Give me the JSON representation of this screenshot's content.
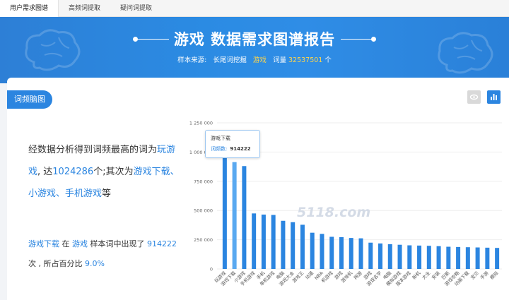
{
  "tabs": [
    {
      "label": "用户需求图谱",
      "active": true
    },
    {
      "label": "高频词提取",
      "active": false
    },
    {
      "label": "疑问词提取",
      "active": false
    }
  ],
  "banner": {
    "title": "游戏 数据需求图谱报告",
    "source_label": "样本来源:",
    "source_value": "长尾词挖掘",
    "keyword": "游戏",
    "count_label": "词量",
    "count_value": "32537501",
    "count_unit": "个"
  },
  "card": {
    "tag": "词频脑图",
    "summary": {
      "p1": "经数据分析得到词频最高的词为",
      "top_word": "玩游戏",
      "p2": ", 达",
      "top_count": "1024286",
      "p3": "个;其次为",
      "second": "游戏下载、小游戏、手机游戏",
      "p4": "等"
    },
    "detail": {
      "word": "游戏下载",
      "p1": "在",
      "sample": "游戏",
      "p2": "样本词中出现了",
      "count": "914222",
      "p3": "次 , 所占百分比",
      "percent": "9.0%"
    }
  },
  "tooltip": {
    "title": "游戏下载",
    "label": "词频数:",
    "value": "914222"
  },
  "watermark": "5118.com",
  "colors": {
    "accent": "#2b85e0",
    "highlight": "#ffd54a",
    "bar": "#2b85e0",
    "bar_active": "#5aa9f0"
  },
  "chart_data": {
    "type": "bar",
    "ylim": [
      0,
      1250000
    ],
    "yticks": [
      0,
      250000,
      500000,
      750000,
      1000000,
      1250000
    ],
    "ytick_labels": [
      "0",
      "250 000",
      "500 000",
      "750 000",
      "1 000 000",
      "1 250 000"
    ],
    "categories": [
      "玩游戏",
      "游戏下载",
      "小游戏",
      "手机游戏",
      "手机",
      "单机游戏",
      "电脑",
      "游戏大全",
      "游戏王",
      "动漫",
      "NBA",
      "机游戏",
      "游戏",
      "游戏机",
      "网游",
      "游戏",
      "游戏名字",
      "电脑",
      "模拟游戏",
      "版本游戏",
      "新机",
      "大全",
      "安装",
      "巴斯",
      "游戏攻略",
      "动画下载",
      "宝贝",
      "手游",
      "模拟"
    ],
    "values": [
      1024286,
      914222,
      880000,
      475000,
      465000,
      462000,
      412000,
      400000,
      378000,
      310000,
      300000,
      275000,
      272000,
      265000,
      262000,
      225000,
      218000,
      212000,
      207000,
      202000,
      200000,
      198000,
      195000,
      190000,
      188000,
      186000,
      184000,
      182000,
      180000
    ],
    "highlight_index": 1
  }
}
